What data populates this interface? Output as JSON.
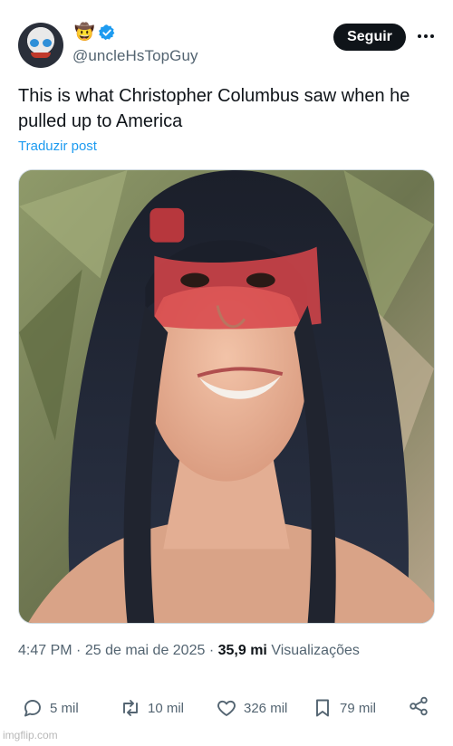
{
  "author": {
    "handle": "@uncleHsTopGuy",
    "badge_emoji": "🤠",
    "verified": true
  },
  "header": {
    "follow_label": "Seguir"
  },
  "post": {
    "text": "This is what Christopher Columbus saw when he pulled up to America",
    "translate_label": "Traduzir post",
    "media_alt": "photo"
  },
  "meta": {
    "time": "4:47 PM",
    "separator": "·",
    "date": "25 de mai de 2025",
    "views_count": "35,9 mi",
    "views_label": "Visualizações"
  },
  "actions": {
    "replies": "5 mil",
    "reposts": "10 mil",
    "likes": "326 mil",
    "bookmarks": "79 mil"
  },
  "watermark": "imgflip.com",
  "colors": {
    "text": "#0f1419",
    "secondary": "#536471",
    "link": "#1d9bf0",
    "button": "#0f1419"
  }
}
